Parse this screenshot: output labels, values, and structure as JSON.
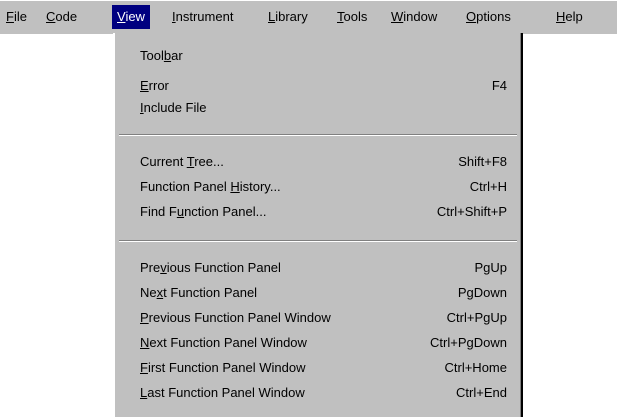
{
  "menubar": {
    "items": [
      {
        "pre": "",
        "key": "F",
        "post": "ile"
      },
      {
        "pre": "",
        "key": "C",
        "post": "ode"
      },
      {
        "pre": "",
        "key": "V",
        "post": "iew"
      },
      {
        "pre": "",
        "key": "I",
        "post": "nstrument"
      },
      {
        "pre": "",
        "key": "L",
        "post": "ibrary"
      },
      {
        "pre": "",
        "key": "T",
        "post": "ools"
      },
      {
        "pre": "",
        "key": "W",
        "post": "indow"
      },
      {
        "pre": "",
        "key": "O",
        "post": "ptions"
      },
      {
        "pre": "",
        "key": "H",
        "post": "elp"
      }
    ],
    "active_index": 2
  },
  "view_menu": {
    "items": [
      {
        "pre": "Tool",
        "key": "b",
        "post": "ar",
        "shortcut": ""
      },
      {
        "pre": "",
        "key": "E",
        "post": "rror",
        "shortcut": "F4"
      },
      {
        "pre": "",
        "key": "I",
        "post": "nclude File",
        "shortcut": ""
      },
      {
        "pre": "Current ",
        "key": "T",
        "post": "ree...",
        "shortcut": "Shift+F8"
      },
      {
        "pre": "Function Panel ",
        "key": "H",
        "post": "istory...",
        "shortcut": "Ctrl+H"
      },
      {
        "pre": "Find F",
        "key": "u",
        "post": "nction Panel...",
        "shortcut": "Ctrl+Shift+P"
      },
      {
        "pre": "Pre",
        "key": "v",
        "post": "ious Function Panel",
        "shortcut": "PgUp"
      },
      {
        "pre": "Ne",
        "key": "x",
        "post": "t Function Panel",
        "shortcut": "PgDown"
      },
      {
        "pre": "",
        "key": "P",
        "post": "revious Function Panel Window",
        "shortcut": "Ctrl+PgUp"
      },
      {
        "pre": "",
        "key": "N",
        "post": "ext Function Panel Window",
        "shortcut": "Ctrl+PgDown"
      },
      {
        "pre": "",
        "key": "F",
        "post": "irst Function Panel Window",
        "shortcut": "Ctrl+Home"
      },
      {
        "pre": "",
        "key": "L",
        "post": "ast Function Panel Window",
        "shortcut": "Ctrl+End"
      }
    ]
  },
  "colors": {
    "menu_background": "#c0c0c0",
    "highlight_background": "#000080",
    "highlight_text": "#ffffff",
    "text": "#000000"
  }
}
